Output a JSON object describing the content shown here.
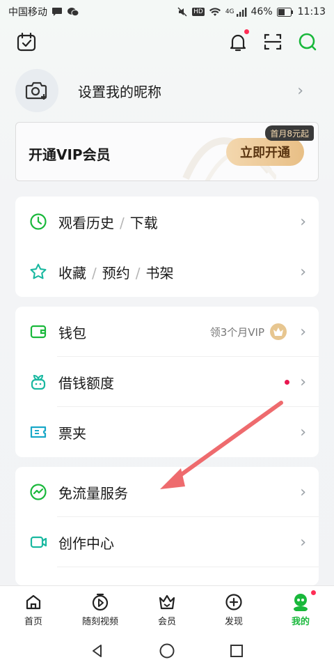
{
  "status_bar": {
    "carrier": "中国移动",
    "battery": "46%",
    "time": "11:13",
    "network": "4G",
    "hd": "HD"
  },
  "header": {
    "icons": [
      "calendar-check-icon",
      "bell-icon",
      "scan-icon",
      "search-icon"
    ]
  },
  "profile": {
    "nickname_prompt": "设置我的昵称"
  },
  "vip_banner": {
    "title": "开通VIP会员",
    "button": "立即开通",
    "promo_tag": "首月8元起"
  },
  "group1": [
    {
      "parts": [
        "观看历史",
        "下载"
      ],
      "icon": "clock-icon"
    },
    {
      "parts": [
        "收藏",
        "预约",
        "书架"
      ],
      "icon": "star-icon"
    }
  ],
  "group2": [
    {
      "label": "钱包",
      "extra": "领3个月VIP",
      "icon": "wallet-icon"
    },
    {
      "label": "借钱额度",
      "icon": "sprout-icon"
    },
    {
      "label": "票夹",
      "icon": "ticket-icon"
    }
  ],
  "group3": [
    {
      "label": "免流量服务",
      "icon": "trend-icon"
    },
    {
      "label": "创作中心",
      "icon": "camera-icon"
    }
  ],
  "separator": "/",
  "tabs": [
    {
      "label": "首页",
      "icon": "home-icon"
    },
    {
      "label": "随刻视频",
      "icon": "play-circle-icon"
    },
    {
      "label": "会员",
      "icon": "crown-icon"
    },
    {
      "label": "发现",
      "icon": "plus-circle-icon"
    },
    {
      "label": "我的",
      "icon": "profile-avatar-icon",
      "active": true
    }
  ],
  "colors": {
    "accent_green": "#19b83b",
    "vip_gold": "#e8bf86",
    "notification_red": "#ff2d55",
    "annotation_arrow": "#ee6b6e"
  }
}
